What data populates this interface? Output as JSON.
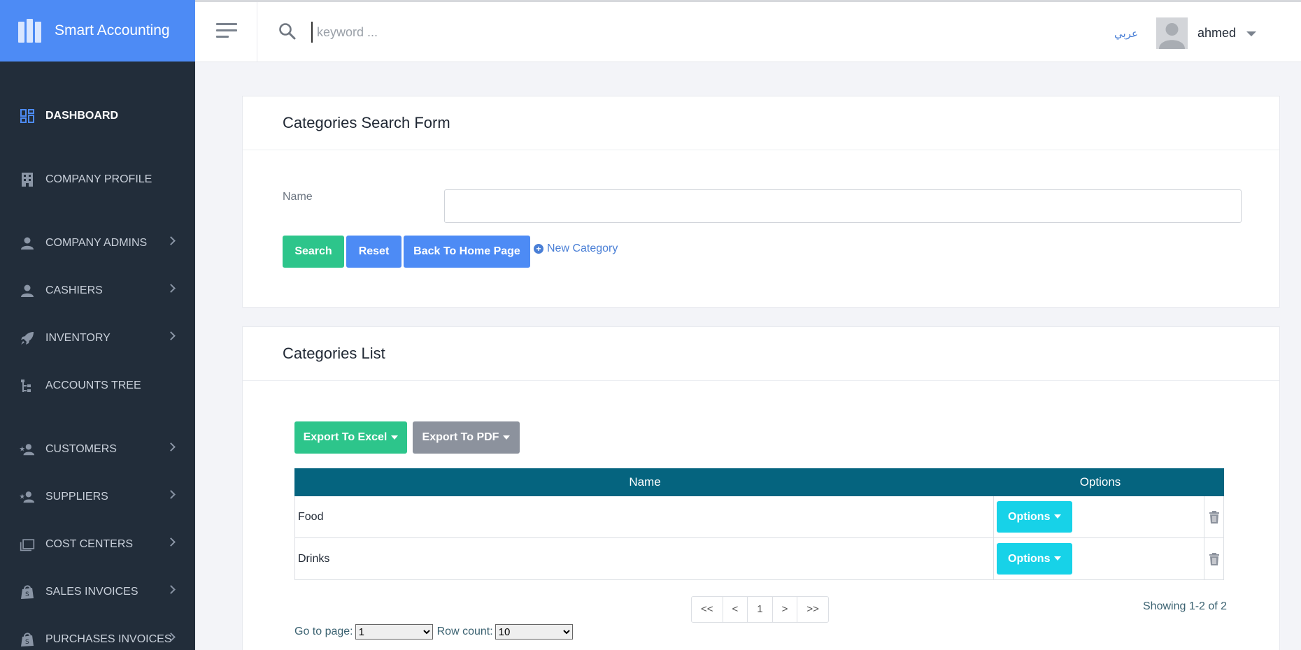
{
  "app": {
    "name": "Smart Accounting"
  },
  "sidebar": {
    "items": [
      {
        "label": "DASHBOARD",
        "icon": "dashboard-icon",
        "active": true,
        "has_children": false
      },
      {
        "label": "COMPANY PROFILE",
        "icon": "building-icon",
        "active": false,
        "has_children": false
      },
      {
        "label": "COMPANY ADMINS",
        "icon": "person-icon",
        "active": false,
        "has_children": true
      },
      {
        "label": "CASHIERS",
        "icon": "person-icon",
        "active": false,
        "has_children": true
      },
      {
        "label": "INVENTORY",
        "icon": "rocket-icon",
        "active": false,
        "has_children": true
      },
      {
        "label": "ACCOUNTS TREE",
        "icon": "tree-icon",
        "active": false,
        "has_children": false
      },
      {
        "label": "CUSTOMERS",
        "icon": "person-star-icon",
        "active": false,
        "has_children": true
      },
      {
        "label": "SUPPLIERS",
        "icon": "person-star-icon",
        "active": false,
        "has_children": true
      },
      {
        "label": "COST CENTERS",
        "icon": "folders-icon",
        "active": false,
        "has_children": true
      },
      {
        "label": "SALES INVOICES",
        "icon": "shopping-bag-icon",
        "active": false,
        "has_children": true
      },
      {
        "label": "PURCHASES INVOICES",
        "icon": "shopping-bag-icon",
        "active": false,
        "has_children": true
      }
    ]
  },
  "topbar": {
    "search_placeholder": "keyword ...",
    "language_link": "عربي",
    "username": "ahmed"
  },
  "search_form": {
    "title": "Categories Search Form",
    "name_label": "Name",
    "name_value": "",
    "search_button": "Search",
    "reset_button": "Reset",
    "back_button": "Back To Home Page",
    "new_link": "New Category"
  },
  "list": {
    "title": "Categories List",
    "export_excel": "Export To Excel",
    "export_pdf": "Export To PDF",
    "columns": {
      "name": "Name",
      "options": "Options"
    },
    "rows": [
      {
        "name": "Food",
        "options_label": "Options"
      },
      {
        "name": "Drinks",
        "options_label": "Options"
      }
    ],
    "pager": {
      "first": "<<",
      "prev": "<",
      "current": "1",
      "next": ">",
      "last": ">>"
    },
    "showing": "Showing 1-2 of 2",
    "go_to_page_label": "Go to page:",
    "go_to_page_value": "1",
    "row_count_label": "Row count:",
    "row_count_value": "10"
  },
  "colors": {
    "brand": "#4d8bf5",
    "sidebar_bg": "#222d3a",
    "table_header": "#05647f",
    "success": "#2dc58b",
    "info": "#17d2e8"
  }
}
